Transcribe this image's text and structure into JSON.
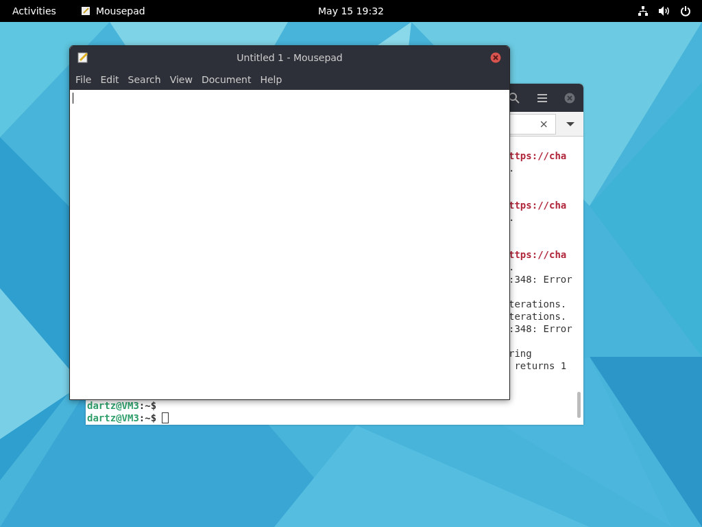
{
  "top_bar": {
    "activities": "Activities",
    "app_name": "Mousepad",
    "clock": "May 15  19:32"
  },
  "terminal": {
    "search_clear": "×",
    "output_lines": [
      {
        "kind": "link",
        "text": "ttps://cha"
      },
      {
        "kind": "plain",
        "text": "."
      },
      {
        "kind": "blank"
      },
      {
        "kind": "blank"
      },
      {
        "kind": "link",
        "text": "ttps://cha"
      },
      {
        "kind": "plain",
        "text": "."
      },
      {
        "kind": "blank"
      },
      {
        "kind": "blank"
      },
      {
        "kind": "link",
        "text": "ttps://cha"
      },
      {
        "kind": "plain",
        "text": "."
      },
      {
        "kind": "plain",
        "text": ":348: Error"
      },
      {
        "kind": "blank"
      },
      {
        "kind": "plain",
        "text": "terations."
      },
      {
        "kind": "plain",
        "text": "terations."
      },
      {
        "kind": "plain",
        "text": ":348: Error"
      },
      {
        "kind": "blank"
      },
      {
        "kind": "plain",
        "text": "ring"
      },
      {
        "kind": "plain",
        "text": " returns 1"
      }
    ],
    "prompt_lines": [
      {
        "user": "dartz@VM3",
        "rest": ":~$"
      },
      {
        "user": "dartz@VM3",
        "rest": ":~$",
        "cursor": true
      }
    ]
  },
  "editor": {
    "title": "Untitled 1 - Mousepad",
    "menu": [
      "File",
      "Edit",
      "Search",
      "View",
      "Document",
      "Help"
    ],
    "cursor": true
  }
}
